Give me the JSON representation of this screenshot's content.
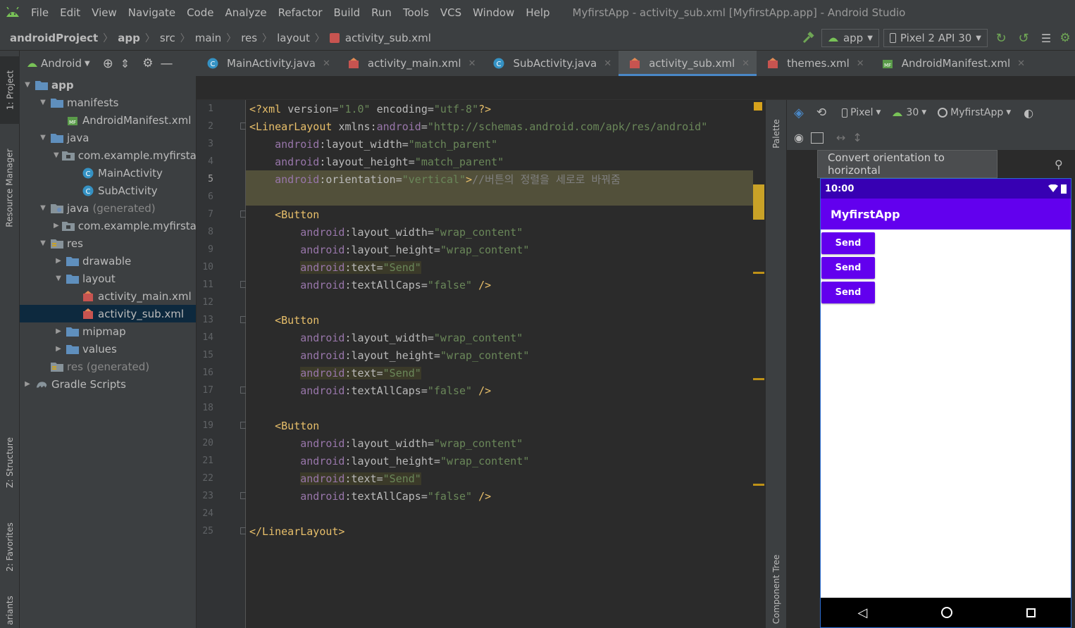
{
  "menubar": {
    "items": [
      "File",
      "Edit",
      "View",
      "Navigate",
      "Code",
      "Analyze",
      "Refactor",
      "Build",
      "Run",
      "Tools",
      "VCS",
      "Window",
      "Help"
    ],
    "window_title": "MyfirstApp - activity_sub.xml [MyfirstApp.app] - Android Studio"
  },
  "navbar": {
    "breadcrumbs": [
      "androidProject",
      "app",
      "src",
      "main",
      "res",
      "layout",
      "activity_sub.xml"
    ],
    "run_config": "app",
    "device": "Pixel 2 API 30"
  },
  "left_strip": {
    "project": "1: Project",
    "resource_manager": "Resource Manager",
    "structure": "Z: Structure",
    "favorites": "2: Favorites",
    "variants": "ariants"
  },
  "project_panel": {
    "view_mode": "Android",
    "tree": [
      {
        "label": "app",
        "depth": 0,
        "expanded": true,
        "icon": "folder-icon",
        "bold": true
      },
      {
        "label": "manifests",
        "depth": 1,
        "expanded": true,
        "icon": "folder-icon"
      },
      {
        "label": "AndroidManifest.xml",
        "depth": 2,
        "icon": "manifest-file-icon"
      },
      {
        "label": "java",
        "depth": 1,
        "expanded": true,
        "icon": "folder-icon"
      },
      {
        "label": "com.example.myfirstap",
        "depth": 2,
        "expanded": true,
        "icon": "package-icon"
      },
      {
        "label": "MainActivity",
        "depth": 3,
        "icon": "class-icon"
      },
      {
        "label": "SubActivity",
        "depth": 3,
        "icon": "class-icon"
      },
      {
        "label": "java",
        "suffix": "(generated)",
        "depth": 1,
        "expanded": true,
        "icon": "generated-folder-icon"
      },
      {
        "label": "com.example.myfirstap",
        "depth": 2,
        "expanded": false,
        "icon": "package-icon"
      },
      {
        "label": "res",
        "depth": 1,
        "expanded": true,
        "icon": "res-folder-icon"
      },
      {
        "label": "drawable",
        "depth": 2,
        "expanded": false,
        "icon": "folder-icon"
      },
      {
        "label": "layout",
        "depth": 2,
        "expanded": true,
        "icon": "folder-icon"
      },
      {
        "label": "activity_main.xml",
        "depth": 3,
        "icon": "xml-layout-icon"
      },
      {
        "label": "activity_sub.xml",
        "depth": 3,
        "icon": "xml-layout-icon",
        "selected": true
      },
      {
        "label": "mipmap",
        "depth": 2,
        "expanded": false,
        "icon": "folder-icon"
      },
      {
        "label": "values",
        "depth": 2,
        "expanded": false,
        "icon": "folder-icon"
      },
      {
        "label": "res",
        "suffix": "(generated)",
        "depth": 1,
        "icon": "res-folder-icon",
        "muted": true
      },
      {
        "label": "Gradle Scripts",
        "depth": 0,
        "expanded": false,
        "icon": "gradle-icon"
      }
    ]
  },
  "editor_tabs": [
    {
      "label": "MainActivity.java",
      "icon": "class-icon",
      "active": false
    },
    {
      "label": "activity_main.xml",
      "icon": "xml-layout-icon",
      "active": false
    },
    {
      "label": "SubActivity.java",
      "icon": "class-icon",
      "active": false
    },
    {
      "label": "activity_sub.xml",
      "icon": "xml-layout-icon",
      "active": true
    },
    {
      "label": "themes.xml",
      "icon": "xml-layout-icon",
      "active": false
    },
    {
      "label": "AndroidManifest.xml",
      "icon": "manifest-file-icon",
      "active": false
    }
  ],
  "editor": {
    "current_line": 5,
    "lines": [
      [
        {
          "c": "tag",
          "t": "<?xml "
        },
        {
          "c": "attr",
          "t": "version="
        },
        {
          "c": "str",
          "t": "\"1.0\""
        },
        {
          "c": "attr",
          "t": " encoding="
        },
        {
          "c": "str",
          "t": "\"utf-8\""
        },
        {
          "c": "tag",
          "t": "?>"
        }
      ],
      [
        {
          "c": "tag",
          "t": "<LinearLayout "
        },
        {
          "c": "attr",
          "t": "xmlns:"
        },
        {
          "c": "attrns",
          "t": "android"
        },
        {
          "c": "attr",
          "t": "="
        },
        {
          "c": "str",
          "t": "\"http://schemas.android.com/apk/res/android\""
        }
      ],
      [
        {
          "c": "attr",
          "t": "    "
        },
        {
          "c": "attrns",
          "t": "android"
        },
        {
          "c": "attr",
          "t": ":layout_width="
        },
        {
          "c": "str",
          "t": "\"match_parent\""
        }
      ],
      [
        {
          "c": "attr",
          "t": "    "
        },
        {
          "c": "attrns",
          "t": "android"
        },
        {
          "c": "attr",
          "t": ":layout_height="
        },
        {
          "c": "str",
          "t": "\"match_parent\""
        }
      ],
      [
        {
          "c": "attr",
          "t": "    "
        },
        {
          "c": "attrns",
          "t": "android"
        },
        {
          "c": "attr",
          "t": ":orientation="
        },
        {
          "c": "str",
          "t": "\"vertical\""
        },
        {
          "c": "tag",
          "t": ">"
        },
        {
          "c": "cmt",
          "t": "//버튼의 정렬을 세로로 바꿔줌"
        }
      ],
      [],
      [
        {
          "c": "attr",
          "t": "    "
        },
        {
          "c": "tag",
          "t": "<Button"
        }
      ],
      [
        {
          "c": "attr",
          "t": "        "
        },
        {
          "c": "attrns",
          "t": "android"
        },
        {
          "c": "attr",
          "t": ":layout_width="
        },
        {
          "c": "str",
          "t": "\"wrap_content\""
        }
      ],
      [
        {
          "c": "attr",
          "t": "        "
        },
        {
          "c": "attrns",
          "t": "android"
        },
        {
          "c": "attr",
          "t": ":layout_height="
        },
        {
          "c": "str",
          "t": "\"wrap_content\""
        }
      ],
      [
        {
          "c": "attr",
          "t": "        "
        },
        {
          "c": "attrns hl",
          "t": "android"
        },
        {
          "c": "attr hl",
          "t": ":text="
        },
        {
          "c": "str hl",
          "t": "\"Send\""
        }
      ],
      [
        {
          "c": "attr",
          "t": "        "
        },
        {
          "c": "attrns",
          "t": "android"
        },
        {
          "c": "attr",
          "t": ":textAllCaps="
        },
        {
          "c": "str",
          "t": "\"false\""
        },
        {
          "c": "tag",
          "t": " />"
        }
      ],
      [],
      [
        {
          "c": "attr",
          "t": "    "
        },
        {
          "c": "tag",
          "t": "<Button"
        }
      ],
      [
        {
          "c": "attr",
          "t": "        "
        },
        {
          "c": "attrns",
          "t": "android"
        },
        {
          "c": "attr",
          "t": ":layout_width="
        },
        {
          "c": "str",
          "t": "\"wrap_content\""
        }
      ],
      [
        {
          "c": "attr",
          "t": "        "
        },
        {
          "c": "attrns",
          "t": "android"
        },
        {
          "c": "attr",
          "t": ":layout_height="
        },
        {
          "c": "str",
          "t": "\"wrap_content\""
        }
      ],
      [
        {
          "c": "attr",
          "t": "        "
        },
        {
          "c": "attrns hl",
          "t": "android"
        },
        {
          "c": "attr hl",
          "t": ":text="
        },
        {
          "c": "str hl",
          "t": "\"Send\""
        }
      ],
      [
        {
          "c": "attr",
          "t": "        "
        },
        {
          "c": "attrns",
          "t": "android"
        },
        {
          "c": "attr",
          "t": ":textAllCaps="
        },
        {
          "c": "str",
          "t": "\"false\""
        },
        {
          "c": "tag",
          "t": " />"
        }
      ],
      [],
      [
        {
          "c": "attr",
          "t": "    "
        },
        {
          "c": "tag",
          "t": "<Button"
        }
      ],
      [
        {
          "c": "attr",
          "t": "        "
        },
        {
          "c": "attrns",
          "t": "android"
        },
        {
          "c": "attr",
          "t": ":layout_width="
        },
        {
          "c": "str",
          "t": "\"wrap_content\""
        }
      ],
      [
        {
          "c": "attr",
          "t": "        "
        },
        {
          "c": "attrns",
          "t": "android"
        },
        {
          "c": "attr",
          "t": ":layout_height="
        },
        {
          "c": "str",
          "t": "\"wrap_content\""
        }
      ],
      [
        {
          "c": "attr",
          "t": "        "
        },
        {
          "c": "attrns hl",
          "t": "android"
        },
        {
          "c": "attr hl",
          "t": ":text="
        },
        {
          "c": "str hl",
          "t": "\"Send\""
        }
      ],
      [
        {
          "c": "attr",
          "t": "        "
        },
        {
          "c": "attrns",
          "t": "android"
        },
        {
          "c": "attr",
          "t": ":textAllCaps="
        },
        {
          "c": "str",
          "t": "\"false\""
        },
        {
          "c": "tag",
          "t": " />"
        }
      ],
      [],
      [
        {
          "c": "tag",
          "t": "</LinearLayout>"
        }
      ]
    ],
    "fold_lines": [
      2,
      7,
      11,
      13,
      17,
      19,
      23,
      25
    ]
  },
  "side_tabs": {
    "palette": "Palette",
    "component_tree": "Component Tree"
  },
  "design": {
    "device": "Pixel",
    "api": "30",
    "theme": "MyfirstApp",
    "tooltip": "Convert orientation to horizontal"
  },
  "phone": {
    "time": "10:00",
    "app_title": "MyfirstApp",
    "buttons": [
      "Send",
      "Send",
      "Send"
    ],
    "colors": {
      "status_bar": "#3700b3",
      "app_bar": "#6200ee",
      "button": "#6200ee"
    }
  }
}
